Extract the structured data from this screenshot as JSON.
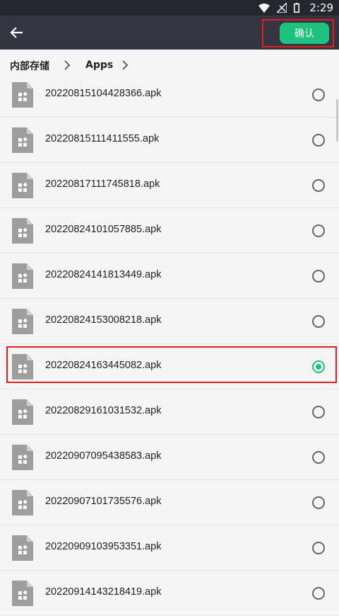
{
  "status": {
    "time": "2:29"
  },
  "toolbar": {
    "confirm_label": "确认"
  },
  "breadcrumb": {
    "root": "内部存储",
    "current": "Apps",
    "separator": "›"
  },
  "files": [
    {
      "name": "20220815104428366.apk",
      "selected": false
    },
    {
      "name": "20220815111411555.apk",
      "selected": false
    },
    {
      "name": "20220817111745818.apk",
      "selected": false
    },
    {
      "name": "20220824101057885.apk",
      "selected": false
    },
    {
      "name": "20220824141813449.apk",
      "selected": false
    },
    {
      "name": "20220824153008218.apk",
      "selected": false
    },
    {
      "name": "20220824163445082.apk",
      "selected": true
    },
    {
      "name": "20220829161031532.apk",
      "selected": false
    },
    {
      "name": "20220907095438583.apk",
      "selected": false
    },
    {
      "name": "20220907101735576.apk",
      "selected": false
    },
    {
      "name": "20220909103953351.apk",
      "selected": false
    },
    {
      "name": "20220914143218419.apk",
      "selected": false
    }
  ],
  "colors": {
    "accent": "#1fc17e",
    "appbar": "#353542",
    "highlight": "#e02020"
  },
  "icons": {
    "back": "arrow-left-icon",
    "file": "apk-file-icon",
    "wifi": "wifi-icon",
    "signal": "no-signal-icon",
    "battery": "battery-icon"
  }
}
